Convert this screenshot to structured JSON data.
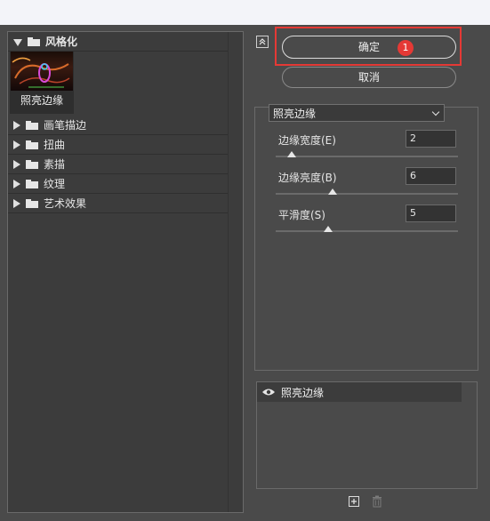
{
  "gallery": {
    "open_group": "风格化",
    "thumbnail_label": "照亮边缘",
    "groups": [
      "画笔描边",
      "扭曲",
      "素描",
      "纹理",
      "艺术效果"
    ]
  },
  "buttons": {
    "ok_label": "确定",
    "cancel_label": "取消",
    "annotation_badge": "1"
  },
  "filter": {
    "selected": "照亮边缘",
    "params": [
      {
        "label": "边缘宽度(E)",
        "value": "2",
        "slider_fraction": 0.09
      },
      {
        "label": "边缘亮度(B)",
        "value": "6",
        "slider_fraction": 0.31
      },
      {
        "label": "平滑度(S)",
        "value": "5",
        "slider_fraction": 0.29
      }
    ]
  },
  "layers": {
    "items": [
      {
        "label": "照亮边缘",
        "visible": true
      }
    ]
  },
  "colors": {
    "highlight_frame": "#e53935",
    "badge": "#e53935"
  }
}
